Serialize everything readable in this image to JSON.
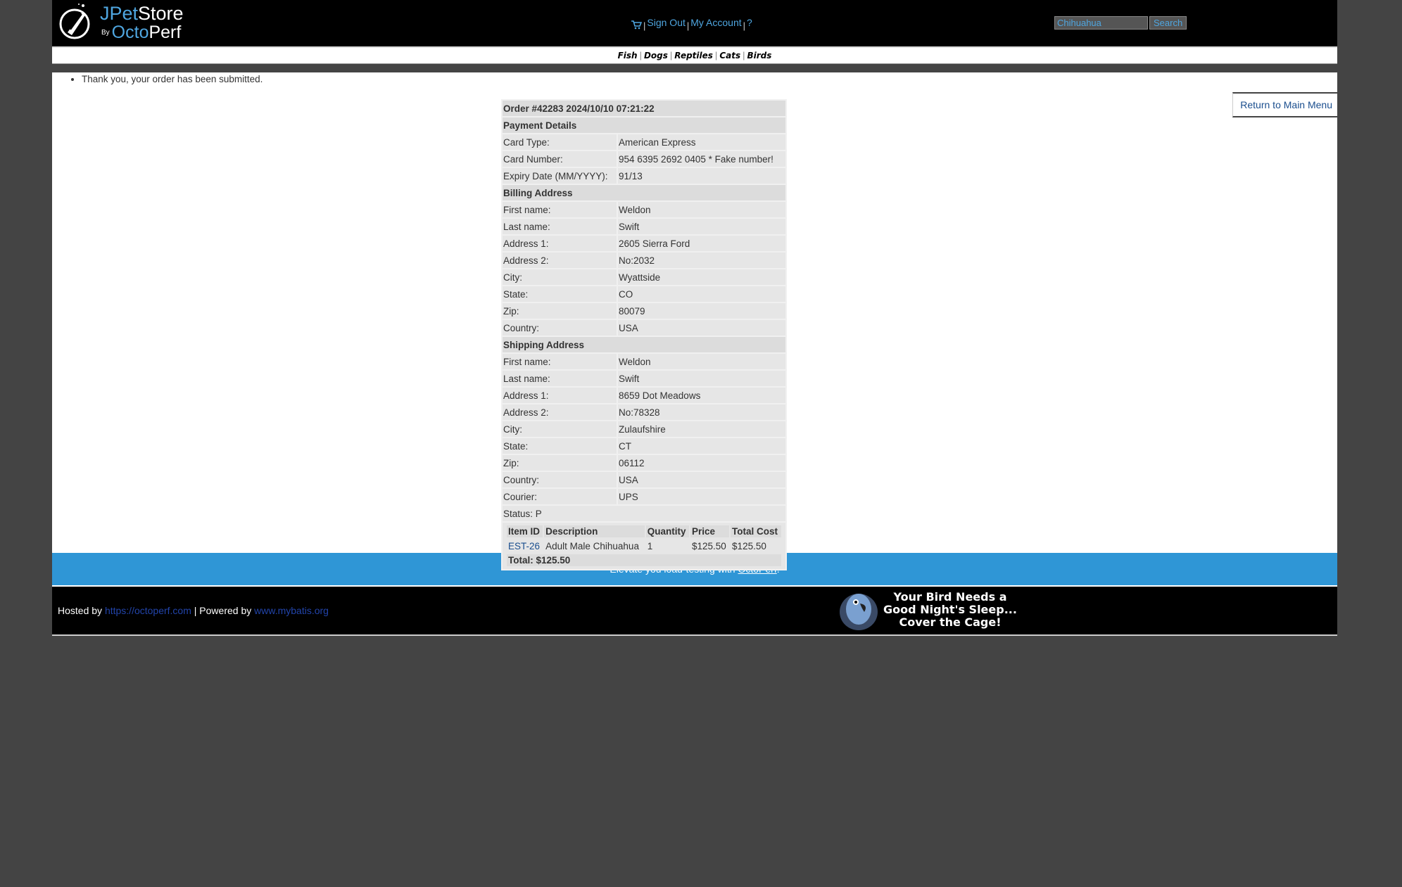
{
  "header": {
    "logo": {
      "brand_j": "JPet",
      "brand_store": "Store",
      "brand_by": "By",
      "brand_octo": "Octo",
      "brand_perf": "Perf"
    },
    "menu": {
      "sign_out": "Sign Out",
      "my_account": "My Account",
      "help": "?",
      "sep": "|"
    },
    "search": {
      "value": "Chihuahua",
      "button": "Search"
    }
  },
  "quicklinks": [
    "Fish",
    "Dogs",
    "Reptiles",
    "Cats",
    "Birds"
  ],
  "messages": [
    "Thank you, your order has been submitted."
  ],
  "return_link": "Return to Main Menu",
  "order": {
    "title": "Order #42283 2024/10/10 07:21:22",
    "payment_header": "Payment Details",
    "payment": [
      {
        "label": "Card Type:",
        "value": "American Express"
      },
      {
        "label": "Card Number:",
        "value": "954 6395 2692 0405 * Fake number!"
      },
      {
        "label": "Expiry Date (MM/YYYY):",
        "value": "91/13"
      }
    ],
    "billing_header": "Billing Address",
    "billing": [
      {
        "label": "First name:",
        "value": "Weldon"
      },
      {
        "label": "Last name:",
        "value": "Swift"
      },
      {
        "label": "Address 1:",
        "value": "2605 Sierra Ford"
      },
      {
        "label": "Address 2:",
        "value": "No:2032"
      },
      {
        "label": "City:",
        "value": "Wyattside"
      },
      {
        "label": "State:",
        "value": "CO"
      },
      {
        "label": "Zip:",
        "value": "80079"
      },
      {
        "label": "Country:",
        "value": "USA"
      }
    ],
    "shipping_header": "Shipping Address",
    "shipping": [
      {
        "label": "First name:",
        "value": "Weldon"
      },
      {
        "label": "Last name:",
        "value": "Swift"
      },
      {
        "label": "Address 1:",
        "value": "8659 Dot Meadows"
      },
      {
        "label": "Address 2:",
        "value": "No:78328"
      },
      {
        "label": "City:",
        "value": "Zulaufshire"
      },
      {
        "label": "State:",
        "value": "CT"
      },
      {
        "label": "Zip:",
        "value": "06112"
      },
      {
        "label": "Country:",
        "value": "USA"
      },
      {
        "label": "Courier:",
        "value": "UPS"
      }
    ],
    "status": "Status: P",
    "items": {
      "columns": [
        "Item ID",
        "Description",
        "Quantity",
        "Price",
        "Total Cost"
      ],
      "rows": [
        {
          "id": "EST-26",
          "description": "Adult Male Chihuahua",
          "quantity": "1",
          "price": "$125.50",
          "total": "$125.50"
        }
      ],
      "total": "Total: $125.50"
    }
  },
  "footer": {
    "band_prefix": "Elevate you load-testing with ",
    "band_link": "OctoPerf",
    "band_suffix": "!",
    "hosted_by": "Hosted by ",
    "hosted_link": "https://octoperf.com",
    "powered_by": " | Powered by ",
    "powered_link": "www.mybatis.org",
    "banner_text": "Your Bird Needs a Good Night's Sleep... Cover the Cage!"
  },
  "colors": {
    "accent": "#4fa6e0",
    "band": "#2f96d6",
    "background": "#444444"
  }
}
